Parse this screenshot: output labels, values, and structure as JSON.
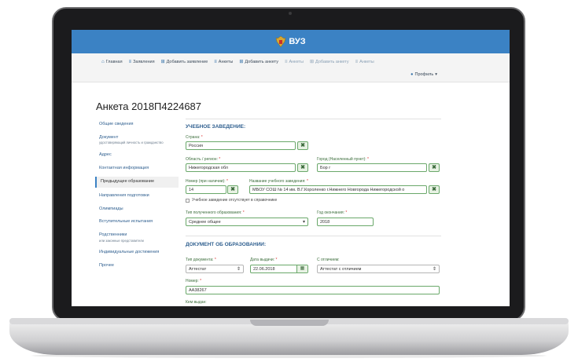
{
  "app": {
    "title": "ВУЗ"
  },
  "nav": [
    {
      "icon": "home-icon",
      "glyph": "⌂",
      "label": "Главная",
      "dim": false
    },
    {
      "icon": "list-icon",
      "glyph": "≡",
      "label": "Заявления",
      "dim": false
    },
    {
      "icon": "plus-icon",
      "glyph": "⊞",
      "label": "Добавить заявление",
      "dim": false
    },
    {
      "icon": "list-icon",
      "glyph": "≡",
      "label": "Анкеты",
      "dim": false
    },
    {
      "icon": "plus-icon",
      "glyph": "⊞",
      "label": "Добавить анкету",
      "dim": false
    },
    {
      "icon": "list-icon",
      "glyph": "≡",
      "label": "Анкеты",
      "dim": true
    },
    {
      "icon": "plus-icon",
      "glyph": "⊞",
      "label": "Добавить анкету",
      "dim": true
    },
    {
      "icon": "list-icon",
      "glyph": "≡",
      "label": "Анкеты",
      "dim": true
    }
  ],
  "profile": {
    "label": "Профиль",
    "glyph": "▾"
  },
  "page_title": "Анкета 2018П4224687",
  "sidebar": [
    {
      "label": "Общие сведения",
      "sub": ""
    },
    {
      "label": "Документ",
      "sub": "удостоверяющий личность и гражданство"
    },
    {
      "label": "Адрес",
      "sub": ""
    },
    {
      "label": "Контактная информация",
      "sub": ""
    },
    {
      "label": "Предыдущее образование",
      "sub": "",
      "active": true
    },
    {
      "label": "Направления подготовки",
      "sub": ""
    },
    {
      "label": "Олимпиады",
      "sub": ""
    },
    {
      "label": "Вступительные испытания",
      "sub": ""
    },
    {
      "label": "Родственники",
      "sub": "или законные представители"
    },
    {
      "label": "Индивидуальные достижения",
      "sub": ""
    },
    {
      "label": "Прочее",
      "sub": ""
    }
  ],
  "school": {
    "section_title": "УЧЕБНОЕ ЗАВЕДЕНИЕ:",
    "country_label": "Страна:",
    "country_value": "Россия",
    "region_label": "Область / регион:",
    "region_value": "Нижегородская обл",
    "city_label": "Город (Населенный пункт):",
    "city_value": "Бор г",
    "number_label": "Номер (при наличии):",
    "number_value": "14",
    "name_label": "Название учебного заведения:",
    "name_value": "МБОУ СОШ № 14 им. В.Г.Короленко г.Нижнего Новгорода Нижегородской о",
    "missing_label": "Учебное заведение отсутствует в справочнике",
    "edu_type_label": "Тип полученного образования:",
    "edu_type_value": "Среднее общее",
    "grad_year_label": "Год окончания:",
    "grad_year_value": "2018"
  },
  "document": {
    "section_title": "ДОКУМЕНТ ОБ ОБРАЗОВАНИИ:",
    "doc_type_label": "Тип документа:",
    "doc_type_value": "Аттестат",
    "issue_date_label": "Дата выдачи:",
    "issue_date_value": "22.06.2018",
    "honors_label": "С отличием:",
    "honors_value": "Аттестат с отличием",
    "number_label": "Номер:",
    "number_value": "АА38267",
    "issued_by_label": "Кем выдан:"
  },
  "required_mark": "*",
  "clear_glyph": "✖",
  "colors": {
    "header": "#3b82c4",
    "accent": "#2f5f8f",
    "field_border": "#6aa86a"
  }
}
